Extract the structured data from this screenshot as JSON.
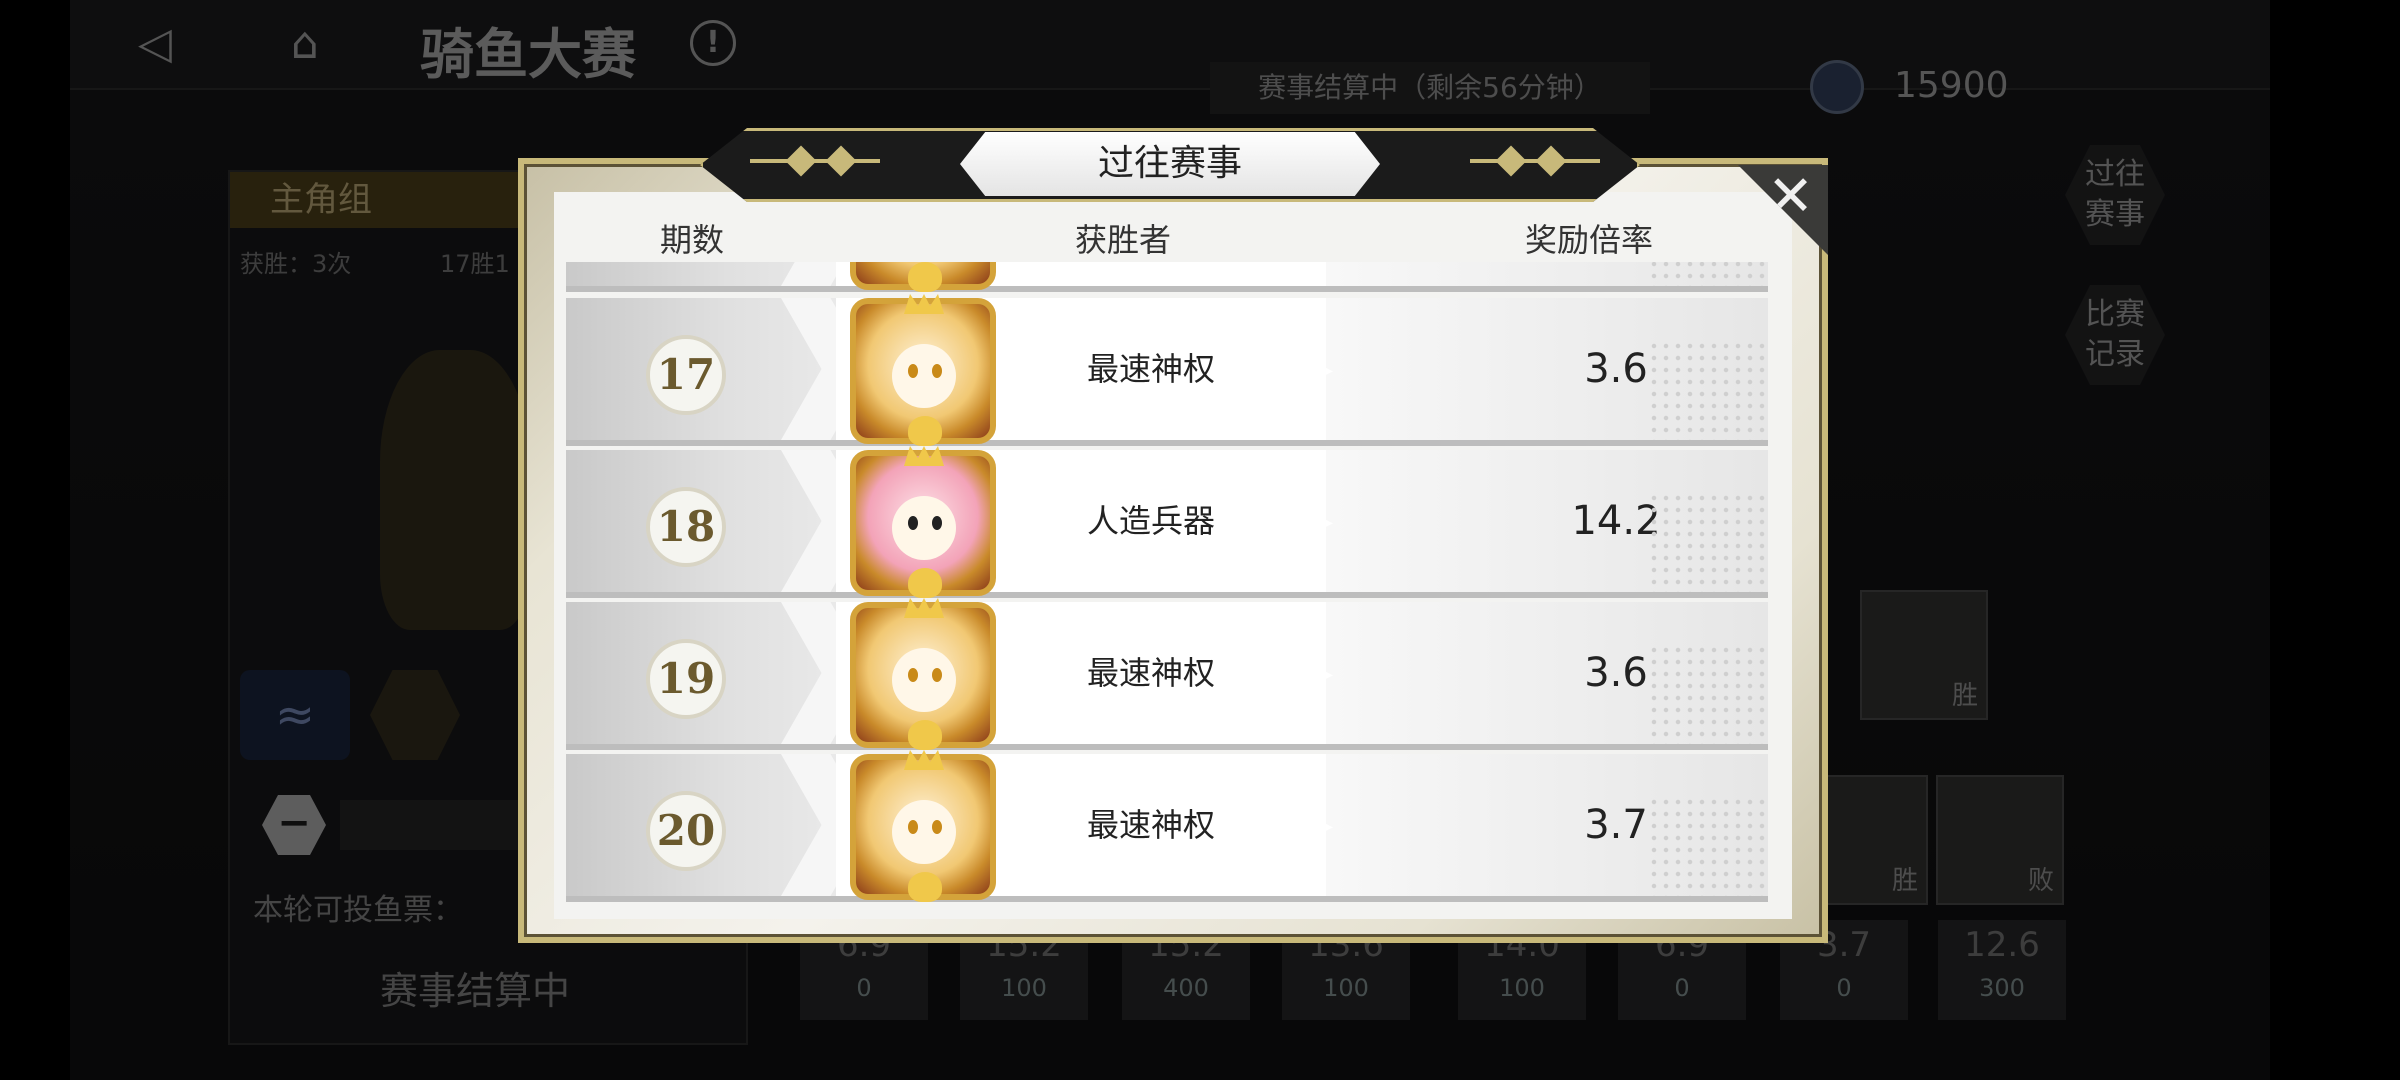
{
  "game": {
    "title": "骑鱼大赛",
    "status": "赛事结算中（剩余56分钟）",
    "currency_value": "15900",
    "side_buttons": [
      "过往\n赛事",
      "比赛\n记录"
    ]
  },
  "left_panel": {
    "group_tab": "主角组",
    "wins": "获胜：3次",
    "record": "17胜1",
    "bet_label": "本轮可投鱼票：",
    "settle_button": "赛事结算中"
  },
  "bottom_odds": [
    {
      "value": "6.9",
      "bets": "0"
    },
    {
      "value": "15.2",
      "bets": "100"
    },
    {
      "value": "15.2",
      "bets": "400"
    },
    {
      "value": "13.6",
      "bets": "100"
    },
    {
      "value": "14.0",
      "bets": "100"
    },
    {
      "value": "6.9",
      "bets": "0"
    },
    {
      "value": "3.7",
      "bets": "0"
    },
    {
      "value": "12.6",
      "bets": "300"
    }
  ],
  "bracket_labels": [
    "胜",
    "胜",
    "败"
  ],
  "modal": {
    "title": "过往赛事",
    "columns": {
      "period": "期数",
      "winner": "获胜者",
      "multiplier": "奖励倍率"
    },
    "rows": [
      {
        "period": "17",
        "winner": "最速神权",
        "multiplier": "3.6",
        "portrait": "brown"
      },
      {
        "period": "18",
        "winner": "人造兵器",
        "multiplier": "14.2",
        "portrait": "pink"
      },
      {
        "period": "19",
        "winner": "最速神权",
        "multiplier": "3.6",
        "portrait": "brown"
      },
      {
        "period": "20",
        "winner": "最速神权",
        "multiplier": "3.7",
        "portrait": "brown"
      }
    ]
  },
  "icons": {
    "back": "back-arrow-icon",
    "home": "home-icon",
    "info": "info-icon",
    "coin": "fish-ticket-icon",
    "close": "close-icon"
  }
}
